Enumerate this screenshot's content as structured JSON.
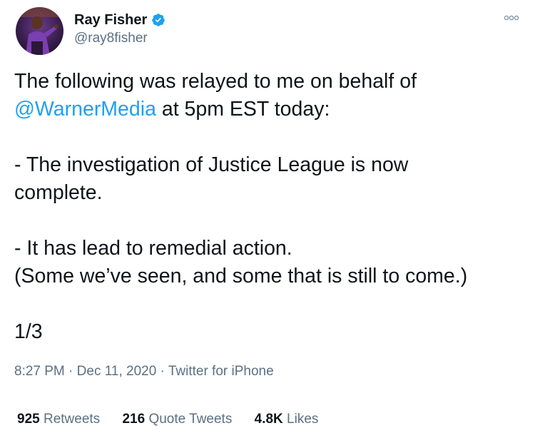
{
  "author": {
    "display_name": "Ray Fisher",
    "handle": "@ray8fisher",
    "verified": true,
    "avatar_icon": "profile-photo"
  },
  "tweet": {
    "line1_text": "The following was relayed to me on behalf of",
    "mention": "@WarnerMedia",
    "line2_rest": " at 5pm EST today:",
    "para2_line1": "- The investigation of Justice League is now",
    "para2_line2": "complete.",
    "para3_line1": "- It has lead to remedial action.",
    "para3_line2": "(Some we’ve seen, and some that is still to come.)",
    "thread_count": "1/3"
  },
  "meta": {
    "time": "8:27 PM",
    "sep1": " · ",
    "date": "Dec 11, 2020",
    "sep2": " · ",
    "source": "Twitter for iPhone"
  },
  "stats": {
    "retweets_count": "925",
    "retweets_label": "Retweets",
    "quotes_count": "216",
    "quotes_label": "Quote Tweets",
    "likes_count": "4.8K",
    "likes_label": "Likes"
  },
  "colors": {
    "link": "#1da1f2",
    "secondary_text": "#5b7083",
    "primary_text": "#0f1419",
    "verified_badge": "#1da1f2"
  },
  "icons": {
    "verified": "verified-badge-icon",
    "more": "more-options-icon"
  }
}
